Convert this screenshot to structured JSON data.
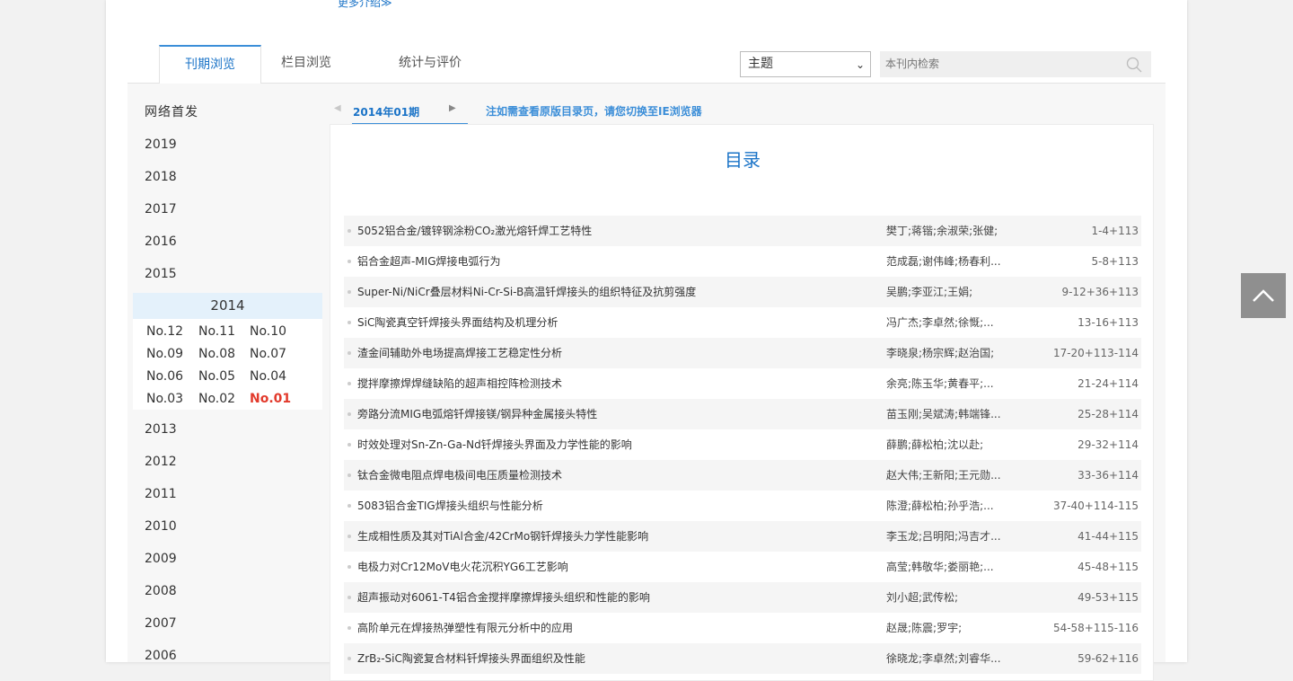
{
  "header": {
    "more_intro": "更多介绍≫"
  },
  "tabs": [
    {
      "label": "刊期浏览"
    },
    {
      "label": "栏目浏览"
    },
    {
      "label": "统计与评价"
    }
  ],
  "search": {
    "field_selected": "主题",
    "placeholder": "本刊内检索"
  },
  "sidebar": {
    "first": "网络首发",
    "years_before": [
      "2019",
      "2018",
      "2017",
      "2016",
      "2015"
    ],
    "expanded_year": "2014",
    "issues": [
      "No.12",
      "No.11",
      "No.10",
      "No.09",
      "No.08",
      "No.07",
      "No.06",
      "No.05",
      "No.04",
      "No.03",
      "No.02",
      "No.01"
    ],
    "current_issue": "No.01",
    "years_after": [
      "2013",
      "2012",
      "2011",
      "2010",
      "2009",
      "2008",
      "2007",
      "2006"
    ]
  },
  "issue_nav": {
    "prev": "◀",
    "label": "2014年01期",
    "next": "▶",
    "notice": "注如需查看原版目录页，请您切换至IE浏览器"
  },
  "toc": {
    "title": "目录",
    "rows": [
      {
        "title": "5052铝合金/镀锌钢涂粉CO₂激光熔钎焊工艺特性",
        "authors": "樊丁;蒋锴;余淑荣;张健;",
        "pages": "1-4+113"
      },
      {
        "title": "铝合金超声-MIG焊接电弧行为",
        "authors": "范成磊;谢伟峰;杨春利...",
        "pages": "5-8+113"
      },
      {
        "title": "Super-Ni/NiCr叠层材料Ni-Cr-Si-B高温钎焊接头的组织特征及抗剪强度",
        "authors": "吴鹏;李亚江;王娟;",
        "pages": "9-12+36+113"
      },
      {
        "title": "SiC陶瓷真空钎焊接头界面结构及机理分析",
        "authors": "冯广杰;李卓然;徐慨;...",
        "pages": "13-16+113"
      },
      {
        "title": "渣金间辅助外电场提高焊接工艺稳定性分析",
        "authors": "李晓泉;杨宗辉;赵治国;",
        "pages": "17-20+113-114"
      },
      {
        "title": "搅拌摩擦焊焊缝缺陷的超声相控阵检测技术",
        "authors": "余亮;陈玉华;黄春平;...",
        "pages": "21-24+114"
      },
      {
        "title": "旁路分流MIG电弧熔钎焊接镁/钢异种金属接头特性",
        "authors": "苗玉刚;吴斌涛;韩端锋...",
        "pages": "25-28+114"
      },
      {
        "title": "时效处理对Sn-Zn-Ga-Nd钎焊接头界面及力学性能的影响",
        "authors": "薛鹏;薛松柏;沈以赴;",
        "pages": "29-32+114"
      },
      {
        "title": "钛合金微电阻点焊电极间电压质量检测技术",
        "authors": "赵大伟;王新阳;王元勋...",
        "pages": "33-36+114"
      },
      {
        "title": "5083铝合金TIG焊接头组织与性能分析",
        "authors": "陈澄;薛松柏;孙乎浩;...",
        "pages": "37-40+114-115"
      },
      {
        "title": "生成相性质及其对TiAl合金/42CrMo钢钎焊接头力学性能影响",
        "authors": "李玉龙;吕明阳;冯吉才...",
        "pages": "41-44+115"
      },
      {
        "title": "电极力对Cr12MoV电火花沉积YG6工艺影响",
        "authors": "高莹;韩敬华;娄丽艳;...",
        "pages": "45-48+115"
      },
      {
        "title": "超声振动对6061-T4铝合金搅拌摩擦焊接头组织和性能的影响",
        "authors": "刘小超;武传松;",
        "pages": "49-53+115"
      },
      {
        "title": "高阶单元在焊接热弹塑性有限元分析中的应用",
        "authors": "赵晟;陈震;罗宇;",
        "pages": "54-58+115-116"
      },
      {
        "title": "ZrB₂-SiC陶瓷复合材料钎焊接头界面组织及性能",
        "authors": "徐晓龙;李卓然;刘睿华...",
        "pages": "59-62+116"
      }
    ]
  },
  "colors": {
    "accent": "#1a73c7",
    "current_issue": "#e23a2c",
    "back_top_bg": "#8f8f8f"
  },
  "icons": {
    "search": "search-icon",
    "back_to_top": "chevron-up-icon",
    "select": "chevron-down-icon"
  }
}
